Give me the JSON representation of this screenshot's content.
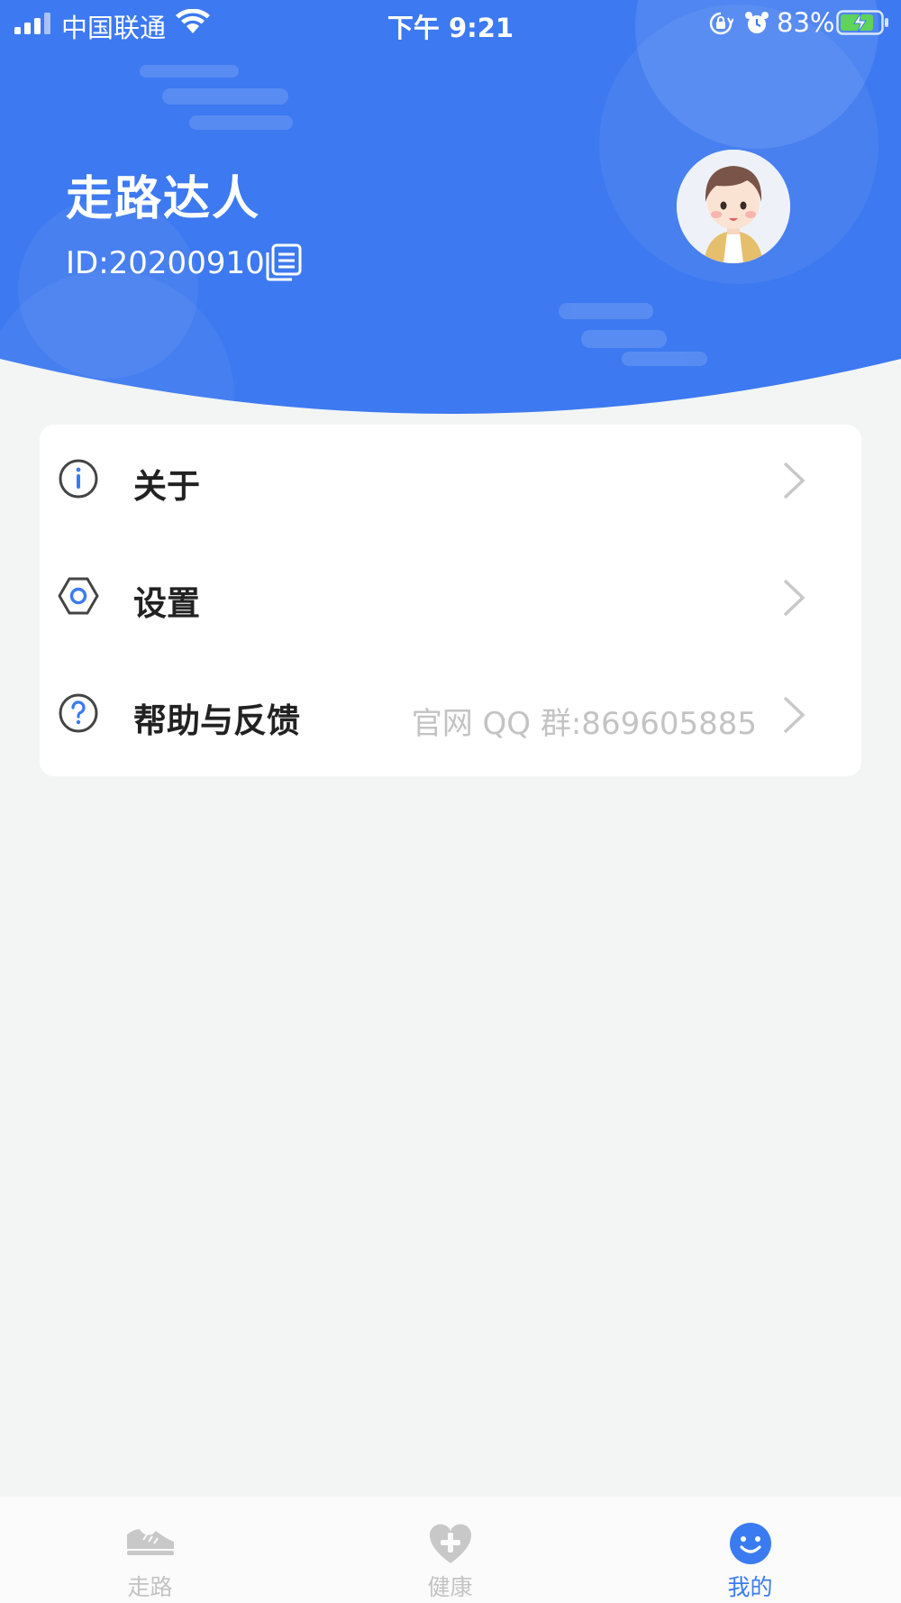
{
  "status_bar": {
    "carrier": "中国联通",
    "time": "下午 9:21",
    "battery_percent": "83%"
  },
  "profile": {
    "name": "走路达人",
    "id_text": "ID:20200910"
  },
  "menu": {
    "items": [
      {
        "label": "关于",
        "icon": "info-icon"
      },
      {
        "label": "设置",
        "icon": "settings-icon"
      },
      {
        "label": "帮助与反馈",
        "icon": "help-icon",
        "extra": "官网 QQ 群:869605885"
      }
    ]
  },
  "tab_bar": {
    "tabs": [
      {
        "label": "走路",
        "icon": "shoe-icon",
        "active": false
      },
      {
        "label": "健康",
        "icon": "heart-plus-icon",
        "active": false
      },
      {
        "label": "我的",
        "icon": "smile-icon",
        "active": true
      }
    ]
  },
  "colors": {
    "header_blue": "#3d79f0",
    "accent": "#3a7bf1",
    "background": "#f3f5f4",
    "muted_text": "#c3c3c3"
  }
}
